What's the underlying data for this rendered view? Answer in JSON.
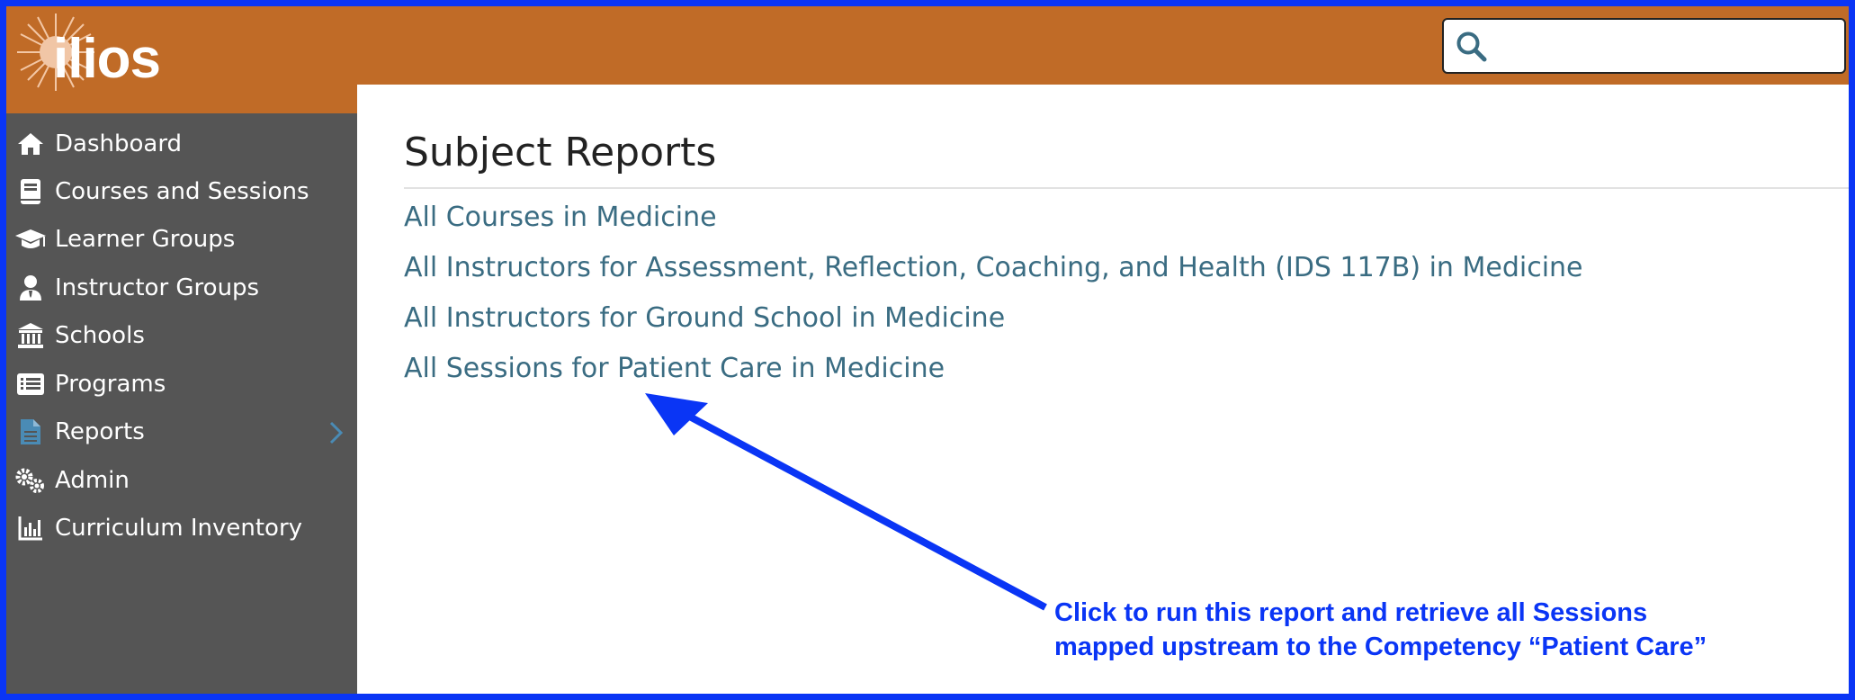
{
  "brand": {
    "name": "ilios"
  },
  "search": {
    "placeholder": ""
  },
  "sidebar": {
    "items": [
      {
        "label": "Dashboard",
        "icon": "home-icon"
      },
      {
        "label": "Courses and Sessions",
        "icon": "book-icon"
      },
      {
        "label": "Learner Groups",
        "icon": "graduation-cap-icon"
      },
      {
        "label": "Instructor Groups",
        "icon": "user-tie-icon"
      },
      {
        "label": "Schools",
        "icon": "university-icon"
      },
      {
        "label": "Programs",
        "icon": "list-alt-icon"
      },
      {
        "label": "Reports",
        "icon": "file-icon"
      },
      {
        "label": "Admin",
        "icon": "cogs-icon"
      },
      {
        "label": "Curriculum Inventory",
        "icon": "chart-bar-icon"
      }
    ]
  },
  "main": {
    "title": "Subject Reports",
    "reports": [
      "All Courses in Medicine",
      "All Instructors for Assessment, Reflection, Coaching, and Health (IDS 117B) in Medicine",
      "All Instructors for Ground School in Medicine",
      "All Sessions for Patient Care in Medicine"
    ]
  },
  "annotation": {
    "line1": "Click to run this report and retrieve all Sessions",
    "line2": "mapped upstream to the Competency “Patient Care”"
  },
  "colors": {
    "header": "#c06b27",
    "sidebar": "#555555",
    "link": "#3a6c82",
    "annotation": "#0a35f5",
    "active_icon": "#4a8bb5"
  }
}
